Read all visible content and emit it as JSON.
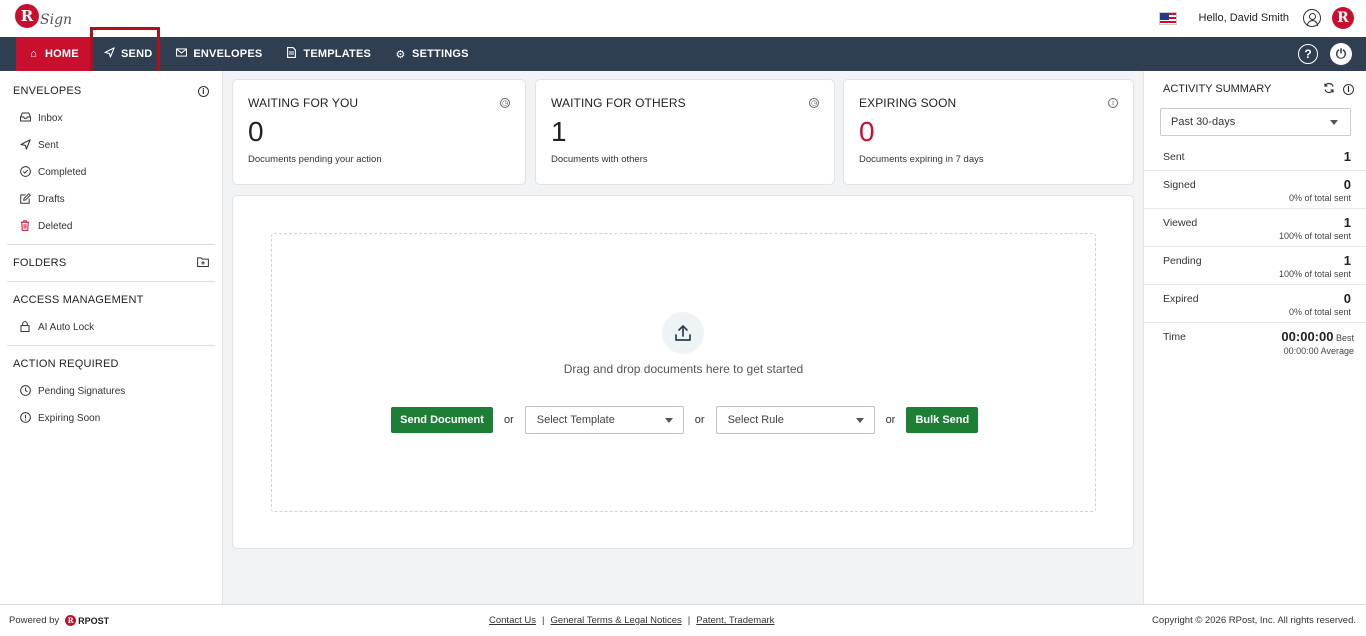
{
  "header": {
    "logo_letter": "R",
    "logo_text": "Sign",
    "greeting": "Hello, David Smith",
    "brand_letter": "R"
  },
  "nav": {
    "items": [
      {
        "label": "HOME",
        "icon": "home-icon"
      },
      {
        "label": "SEND",
        "icon": "send-icon"
      },
      {
        "label": "ENVELOPES",
        "icon": "envelope-icon"
      },
      {
        "label": "TEMPLATES",
        "icon": "template-icon"
      },
      {
        "label": "SETTINGS",
        "icon": "gear-icon"
      }
    ],
    "help_label": "?",
    "active": "HOME"
  },
  "sidebar": {
    "envelopes_title": "ENVELOPES",
    "envelopes": [
      {
        "label": "Inbox"
      },
      {
        "label": "Sent"
      },
      {
        "label": "Completed"
      },
      {
        "label": "Drafts"
      },
      {
        "label": "Deleted"
      }
    ],
    "folders_title": "FOLDERS",
    "access_title": "ACCESS MANAGEMENT",
    "access_items": [
      {
        "label": "AI Auto Lock"
      }
    ],
    "action_title": "ACTION REQUIRED",
    "action_items": [
      {
        "label": "Pending Signatures"
      },
      {
        "label": "Expiring Soon"
      }
    ]
  },
  "cards": [
    {
      "title": "WAITING FOR YOU",
      "value": "0",
      "subtitle": "Documents pending your action"
    },
    {
      "title": "WAITING FOR OTHERS",
      "value": "1",
      "subtitle": "Documents with others"
    },
    {
      "title": "EXPIRING SOON",
      "value": "0",
      "subtitle": "Documents expiring in 7 days"
    }
  ],
  "upload": {
    "drop_text": "Drag and drop documents here to get started",
    "send_document": "Send Document",
    "or": "or",
    "select_template": "Select Template",
    "select_rule": "Select Rule",
    "bulk_send": "Bulk Send"
  },
  "activity": {
    "title": "ACTIVITY SUMMARY",
    "period": "Past 30-days",
    "stats": [
      {
        "label": "Sent",
        "value": "1",
        "sub": ""
      },
      {
        "label": "Signed",
        "value": "0",
        "sub": "0% of total sent"
      },
      {
        "label": "Viewed",
        "value": "1",
        "sub": "100% of total sent"
      },
      {
        "label": "Pending",
        "value": "1",
        "sub": "100% of total sent"
      },
      {
        "label": "Expired",
        "value": "0",
        "sub": "0% of total sent"
      }
    ],
    "time_label": "Time",
    "time_best": "00:00:00",
    "time_best_label": "Best",
    "time_avg": "00:00:00",
    "time_avg_label": "Average"
  },
  "footer": {
    "powered_by": "Powered by",
    "rpost": "RPOST",
    "links": [
      "Contact Us",
      "General Terms & Legal Notices",
      "Patent, Trademark"
    ],
    "separator": "|",
    "copyright": "Copyright © 2026 RPost, Inc. All rights reserved."
  },
  "colors": {
    "brand_red": "#c8102e",
    "nav_bg": "#2f3e50",
    "green": "#1c7f35"
  }
}
